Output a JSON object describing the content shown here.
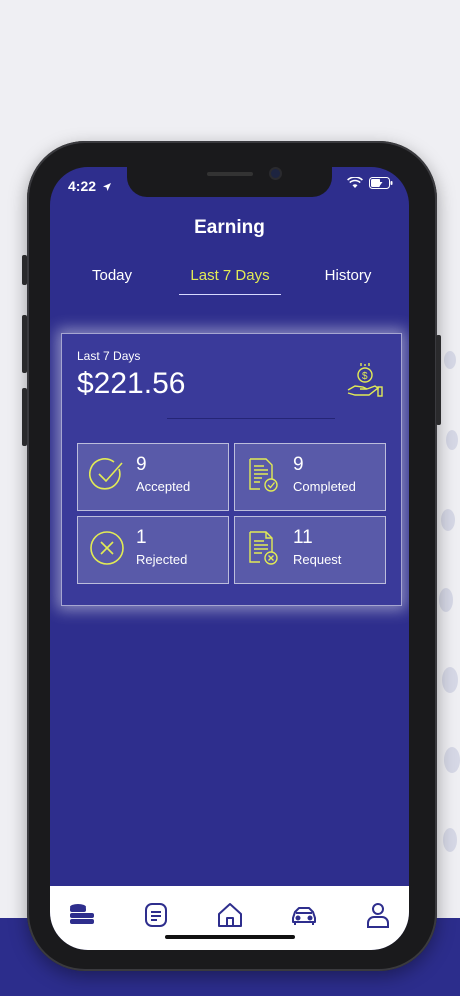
{
  "status": {
    "time": "4:22"
  },
  "header": {
    "title": "Earning"
  },
  "tabs": [
    {
      "label": "Today"
    },
    {
      "label": "Last 7 Days",
      "active": true
    },
    {
      "label": "History"
    }
  ],
  "summary": {
    "period_label": "Last 7 Days",
    "amount": "$221.56",
    "icon": "money-hand-icon"
  },
  "stats": [
    {
      "value": "9",
      "label": "Accepted",
      "icon": "check-circle-icon"
    },
    {
      "value": "9",
      "label": "Completed",
      "icon": "document-check-icon"
    },
    {
      "value": "1",
      "label": "Rejected",
      "icon": "x-circle-icon"
    },
    {
      "value": "11",
      "label": "Request",
      "icon": "document-x-icon"
    }
  ],
  "nav": [
    {
      "icon": "coins-icon"
    },
    {
      "icon": "document-list-icon"
    },
    {
      "icon": "home-icon"
    },
    {
      "icon": "car-icon"
    },
    {
      "icon": "user-icon"
    }
  ],
  "colors": {
    "brand": "#2e2e8d",
    "accent": "#e2eb55",
    "card": "#3a3a9a",
    "stat_tile": "#595aa9"
  }
}
